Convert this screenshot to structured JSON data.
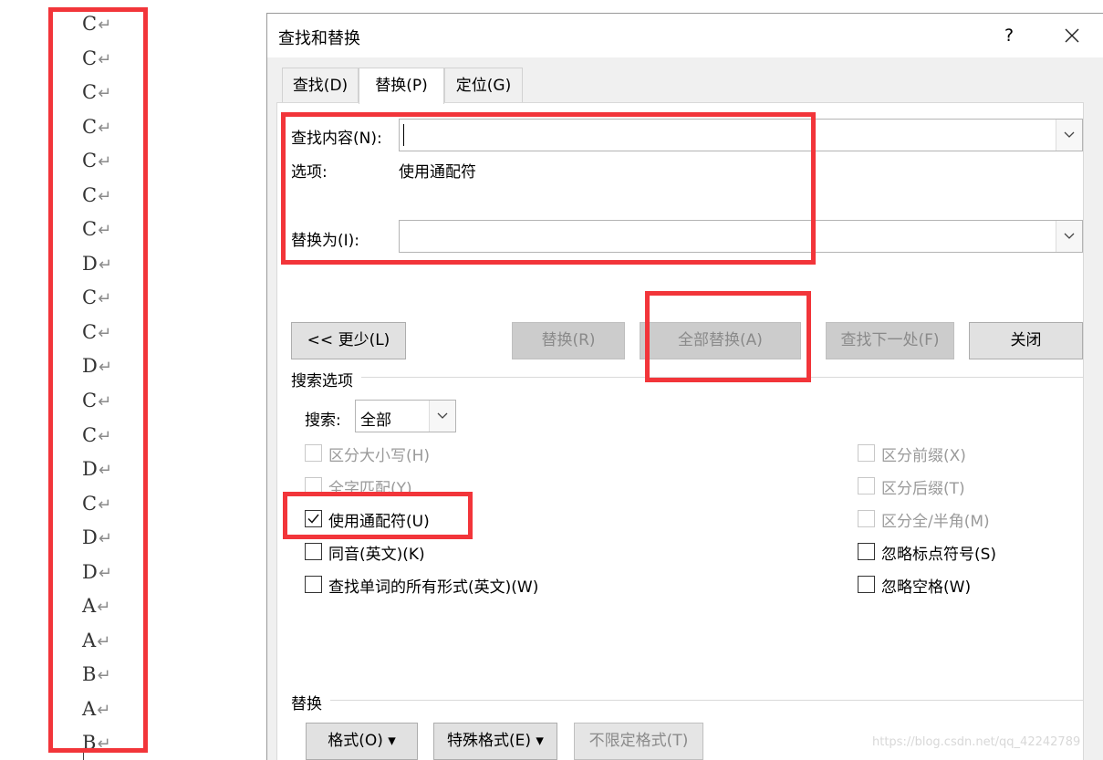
{
  "document": {
    "lines": [
      "C",
      "C",
      "C",
      "C",
      "C",
      "C",
      "C",
      "D",
      "C",
      "C",
      "D",
      "C",
      "C",
      "D",
      "C",
      "D",
      "D",
      "A",
      "A",
      "B",
      "A",
      "B"
    ],
    "paragraph_mark": "↵"
  },
  "dialog": {
    "title": "查找和替换",
    "help": "?",
    "tabs": [
      "查找(D)",
      "替换(P)",
      "定位(G)"
    ],
    "find_label": "查找内容(N):",
    "find_value": "",
    "options_label": "选项:",
    "options_value": "使用通配符",
    "replace_label": "替换为(I):",
    "replace_value": "",
    "buttons": {
      "less": "<< 更少(L)",
      "replace": "替换(R)",
      "replace_all": "全部替换(A)",
      "find_next": "查找下一处(F)",
      "close": "关闭"
    },
    "search_options_heading": "搜索选项",
    "search_label": "搜索:",
    "search_value": "全部",
    "left_checkboxes": [
      {
        "label": "区分大小写(H)",
        "checked": false,
        "enabled": false
      },
      {
        "label": "全字匹配(Y)",
        "checked": false,
        "enabled": false
      },
      {
        "label": "使用通配符(U)",
        "checked": true,
        "enabled": true
      },
      {
        "label": "同音(英文)(K)",
        "checked": false,
        "enabled": true
      },
      {
        "label": "查找单词的所有形式(英文)(W)",
        "checked": false,
        "enabled": true
      }
    ],
    "right_checkboxes": [
      {
        "label": "区分前缀(X)",
        "checked": false,
        "enabled": false
      },
      {
        "label": "区分后缀(T)",
        "checked": false,
        "enabled": false
      },
      {
        "label": "区分全/半角(M)",
        "checked": false,
        "enabled": false
      },
      {
        "label": "忽略标点符号(S)",
        "checked": false,
        "enabled": true
      },
      {
        "label": "忽略空格(W)",
        "checked": false,
        "enabled": true
      }
    ],
    "replace_heading": "替换",
    "bottom_buttons": {
      "format": "格式(O) ▾",
      "special": "特殊格式(E) ▾",
      "no_format": "不限定格式(T)"
    }
  },
  "watermark": "https://blog.csdn.net/qq_42242789",
  "colors": {
    "highlight_box": "#f2353a",
    "dialog_bg": "#f0f0f0"
  }
}
